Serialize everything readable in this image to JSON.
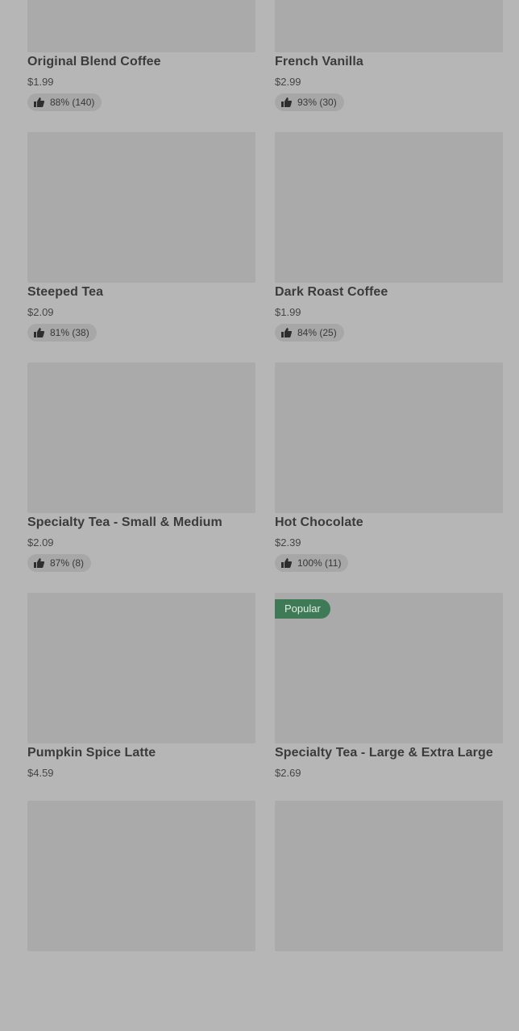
{
  "products": [
    {
      "name": "Original Blend Coffee",
      "price": "$1.99",
      "rating": "88% (140)",
      "badge": null
    },
    {
      "name": "French Vanilla",
      "price": "$2.99",
      "rating": "93% (30)",
      "badge": null
    },
    {
      "name": "Steeped Tea",
      "price": "$2.09",
      "rating": "81% (38)",
      "badge": null
    },
    {
      "name": "Dark Roast Coffee",
      "price": "$1.99",
      "rating": "84% (25)",
      "badge": null
    },
    {
      "name": "Specialty Tea - Small & Medium",
      "price": "$2.09",
      "rating": "87% (8)",
      "badge": null
    },
    {
      "name": "Hot Chocolate",
      "price": "$2.39",
      "rating": "100% (11)",
      "badge": null
    },
    {
      "name": "Pumpkin Spice Latte",
      "price": "$4.59",
      "rating": null,
      "badge": null
    },
    {
      "name": "Specialty Tea - Large & Extra Large",
      "price": "$2.69",
      "rating": null,
      "badge": "Popular"
    },
    {
      "name": "",
      "price": "",
      "rating": null,
      "badge": null
    },
    {
      "name": "",
      "price": "",
      "rating": null,
      "badge": null
    }
  ],
  "icons": {
    "rating": "thumbs-up-icon"
  },
  "colors": {
    "background": "#b6b6b6",
    "thumbnail": "#aaaaaa",
    "badge": "#3d7a55"
  }
}
